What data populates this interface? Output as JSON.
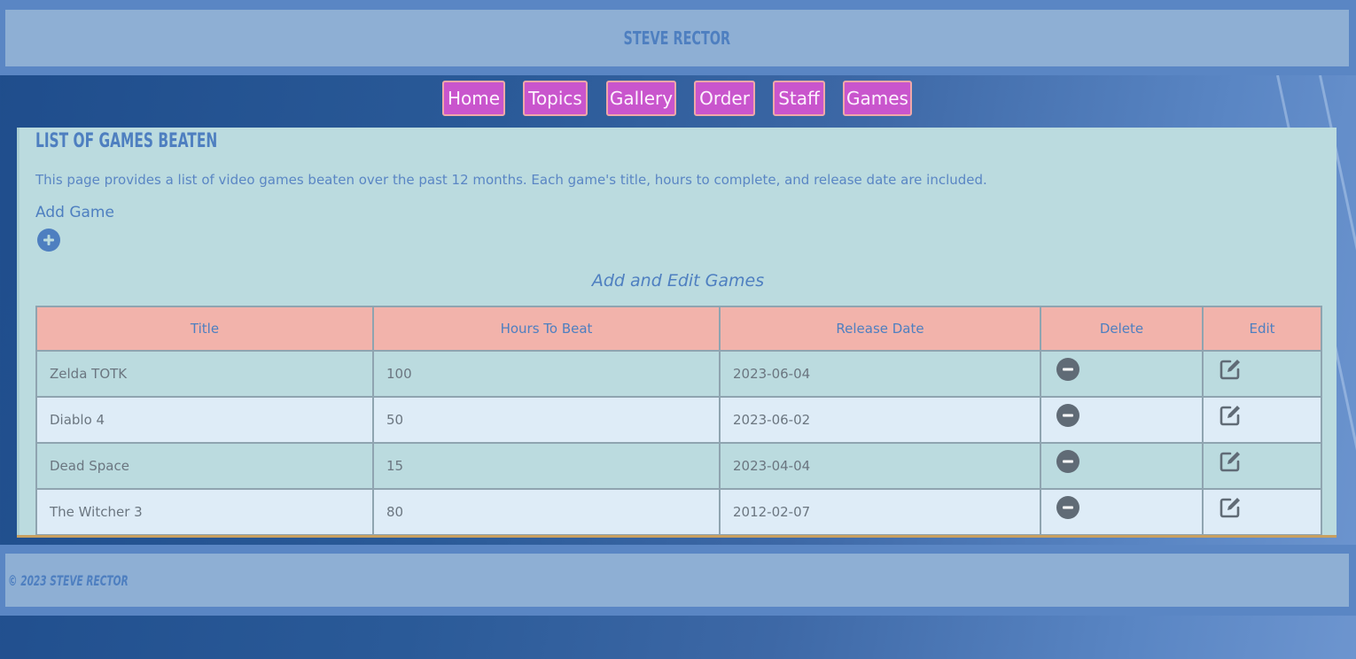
{
  "header": {
    "title": "Steve Rector"
  },
  "nav": {
    "items": [
      "Home",
      "Topics",
      "Gallery",
      "Order",
      "Staff",
      "Games"
    ]
  },
  "main": {
    "heading": "List of Games Beaten",
    "intro": "This page provides a list of video games beaten over the past 12 months. Each game's title, hours to complete, and release date are included.",
    "add_label": "Add Game",
    "add_icon": "plus-circle-icon",
    "table": {
      "caption": "Add and Edit Games",
      "headers": [
        "Title",
        "Hours To Beat",
        "Release Date",
        "Delete",
        "Edit"
      ],
      "rows": [
        {
          "title": "Zelda TOTK",
          "hours": "100",
          "release": "2023-06-04"
        },
        {
          "title": "Diablo 4",
          "hours": "50",
          "release": "2023-06-02"
        },
        {
          "title": "Dead Space",
          "hours": "15",
          "release": "2023-04-04"
        },
        {
          "title": "The Witcher 3",
          "hours": "80",
          "release": "2012-02-07"
        }
      ],
      "delete_icon": "minus-circle-icon",
      "edit_icon": "edit-icon"
    }
  },
  "footer": {
    "text": "© 2023 Steve Rector"
  },
  "colors": {
    "header_bg": "#8eafd4",
    "accent_text": "#4e7fc0",
    "nav_button": "#c955cd",
    "table_header": "#f2b3ab",
    "row_odd": "#bbdbdf",
    "row_even": "#deecf7"
  }
}
